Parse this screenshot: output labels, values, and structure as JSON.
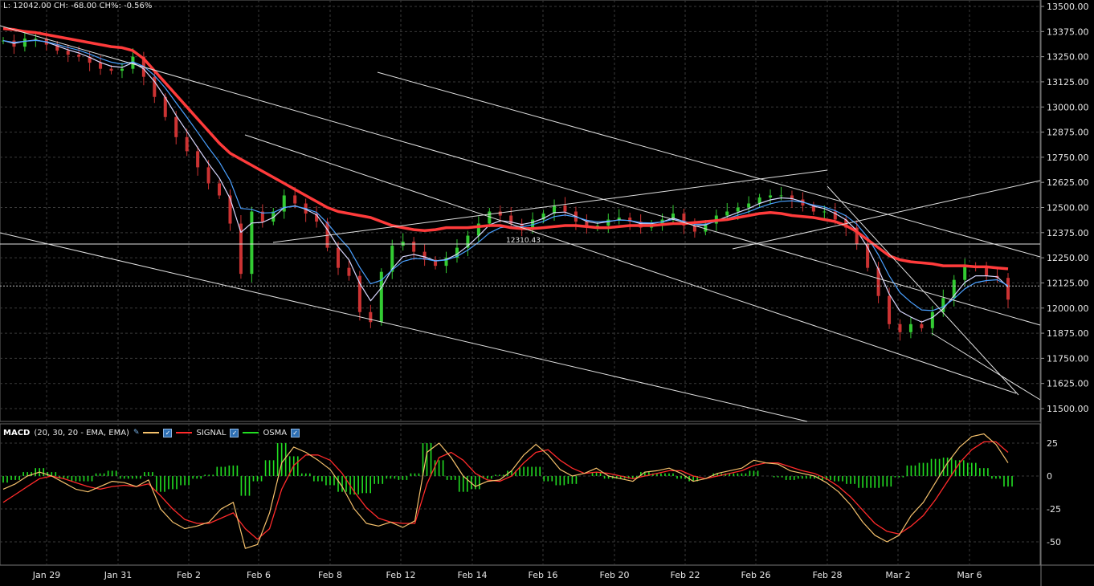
{
  "header": {
    "summary": "L: 12042.00 CH: -68.00 CH%: -0.56%"
  },
  "colors": {
    "background": "#000000",
    "grid": "#3a3a3a",
    "candle_up": "#33cc33",
    "candle_down": "#cc3333",
    "ma_long": "#ff3b3b",
    "ma_fast_blue": "#4aa0ff",
    "ma_fast_white": "#d8d8ff",
    "trendline": "#e0e0e0",
    "macd_line": "#f5c16c",
    "signal_line": "#ff2a2a",
    "osma_bar": "#22dd22"
  },
  "price_axis": {
    "ticks": [
      "13500.00",
      "13375.00",
      "13250.00",
      "13125.00",
      "13000.00",
      "12875.00",
      "12750.00",
      "12625.00",
      "12500.00",
      "12375.00",
      "12250.00",
      "12125.00",
      "12000.00",
      "11875.00",
      "11750.00",
      "11625.00",
      "11500.00"
    ],
    "range": [
      11500,
      13500
    ]
  },
  "price_label": "12310.43",
  "macd_panel": {
    "title": "MACD",
    "params": "(20, 30, 20 - EMA, EMA)",
    "signal_label": "SIGNAL",
    "osma_label": "OSMA",
    "checkmark": "✓",
    "ticks": [
      "25",
      "0",
      "-25",
      "-50"
    ],
    "range": [
      -50,
      25
    ]
  },
  "date_axis": {
    "labels": [
      "Jan 29",
      "Jan 31",
      "Feb 2",
      "Feb 6",
      "Feb 8",
      "Feb 12",
      "Feb 14",
      "Feb 16",
      "Feb 20",
      "Feb 22",
      "Feb 26",
      "Feb 28",
      "Mar 2",
      "Mar 6"
    ]
  },
  "chart_data": {
    "type": "line",
    "title": "",
    "series": [
      {
        "name": "",
        "values": [
          13330,
          13300,
          13340,
          13340,
          13310,
          13280,
          13260,
          13250,
          13220,
          13190,
          13180,
          13190,
          13250,
          13150,
          13050,
          12950,
          12850,
          12780,
          12700,
          12620,
          12560,
          12420,
          12170,
          12480,
          12430,
          12480,
          12560,
          12520,
          12470,
          12430,
          12300,
          12200,
          12160,
          11980,
          11930,
          12180,
          12310,
          12330,
          12280,
          12240,
          12210,
          12250,
          12300,
          12360,
          12420,
          12480,
          12460,
          12420,
          12400,
          12440,
          12470,
          12510,
          12480,
          12430,
          12400,
          12410,
          12440,
          12450,
          12430,
          12400,
          12420,
          12440,
          12470,
          12410,
          12380,
          12420,
          12460,
          12480,
          12500,
          12520,
          12550,
          12560,
          12560,
          12540,
          12510,
          12480,
          12480,
          12440,
          12400,
          12320,
          12200,
          12060,
          11920,
          11880,
          11920,
          11900,
          11980,
          12050,
          12140,
          12210,
          12200,
          12160,
          12150,
          12042
        ]
      },
      {
        "name": "",
        "values": [
          13390,
          13385,
          13375,
          13370,
          13360,
          13350,
          13340,
          13330,
          13320,
          13310,
          13300,
          13295,
          13280,
          13240,
          13180,
          13120,
          13060,
          13000,
          12940,
          12880,
          12820,
          12770,
          12740,
          12710,
          12680,
          12650,
          12620,
          12590,
          12560,
          12530,
          12500,
          12480,
          12470,
          12460,
          12450,
          12430,
          12410,
          12400,
          12390,
          12385,
          12390,
          12400,
          12400,
          12400,
          12405,
          12410,
          12410,
          12400,
          12395,
          12395,
          12400,
          12405,
          12410,
          12410,
          12405,
          12400,
          12400,
          12405,
          12410,
          12410,
          12410,
          12415,
          12420,
          12420,
          12425,
          12430,
          12435,
          12440,
          12450,
          12460,
          12470,
          12475,
          12470,
          12460,
          12455,
          12450,
          12440,
          12430,
          12410,
          12380,
          12340,
          12300,
          12260,
          12240,
          12230,
          12225,
          12220,
          12210,
          12210,
          12210,
          12205,
          12205,
          12200,
          12195
        ]
      }
    ],
    "macd_series": [
      {
        "name": "MACD",
        "values": [
          -10,
          -6,
          0,
          3,
          0,
          -5,
          -10,
          -12,
          -8,
          -4,
          -5,
          -8,
          -3,
          -25,
          -35,
          -40,
          -38,
          -35,
          -25,
          -20,
          -55,
          -52,
          -28,
          10,
          22,
          18,
          12,
          5,
          -8,
          -25,
          -36,
          -38,
          -35,
          -39,
          -34,
          18,
          25,
          14,
          0,
          -8,
          -4,
          -3,
          4,
          16,
          24,
          16,
          5,
          0,
          2,
          6,
          0,
          -2,
          -4,
          3,
          4,
          6,
          2,
          -4,
          -2,
          2,
          4,
          6,
          12,
          10,
          9,
          4,
          2,
          0,
          -5,
          -12,
          -22,
          -35,
          -45,
          -50,
          -45,
          -30,
          -20,
          -5,
          10,
          22,
          30,
          32,
          24,
          10
        ]
      },
      {
        "name": "SIGNAL",
        "values": [
          -20,
          -14,
          -8,
          -2,
          0,
          -2,
          -5,
          -8,
          -10,
          -8,
          -7,
          -8,
          -6,
          -15,
          -25,
          -33,
          -36,
          -36,
          -32,
          -28,
          -40,
          -48,
          -40,
          -10,
          8,
          16,
          16,
          12,
          2,
          -12,
          -24,
          -32,
          -35,
          -36,
          -36,
          -6,
          14,
          18,
          12,
          2,
          -3,
          -4,
          0,
          10,
          18,
          20,
          12,
          6,
          2,
          3,
          2,
          0,
          -2,
          0,
          2,
          4,
          4,
          0,
          -2,
          0,
          2,
          4,
          8,
          10,
          10,
          7,
          4,
          2,
          -2,
          -8,
          -16,
          -26,
          -36,
          -42,
          -44,
          -38,
          -30,
          -18,
          -4,
          10,
          20,
          26,
          26,
          18
        ]
      }
    ],
    "osma_values": [
      -5,
      -3,
      3,
      6,
      3,
      -2,
      -4,
      -4,
      2,
      4,
      -2,
      -2,
      3,
      -12,
      -10,
      -7,
      -2,
      1,
      7,
      8,
      -15,
      -4,
      12,
      25,
      15,
      2,
      -4,
      -7,
      -12,
      -14,
      -13,
      -6,
      -2,
      -3,
      2,
      25,
      12,
      -3,
      -12,
      -10,
      -2,
      1,
      4,
      7,
      7,
      -4,
      -7,
      -6,
      0,
      3,
      -2,
      -2,
      -2,
      3,
      2,
      2,
      -2,
      -4,
      0,
      2,
      2,
      2,
      4,
      0,
      -1,
      -3,
      -2,
      -2,
      -3,
      -4,
      -6,
      -9,
      -9,
      -8,
      -1,
      8,
      10,
      13,
      14,
      12,
      10,
      6,
      -2,
      -8
    ]
  }
}
